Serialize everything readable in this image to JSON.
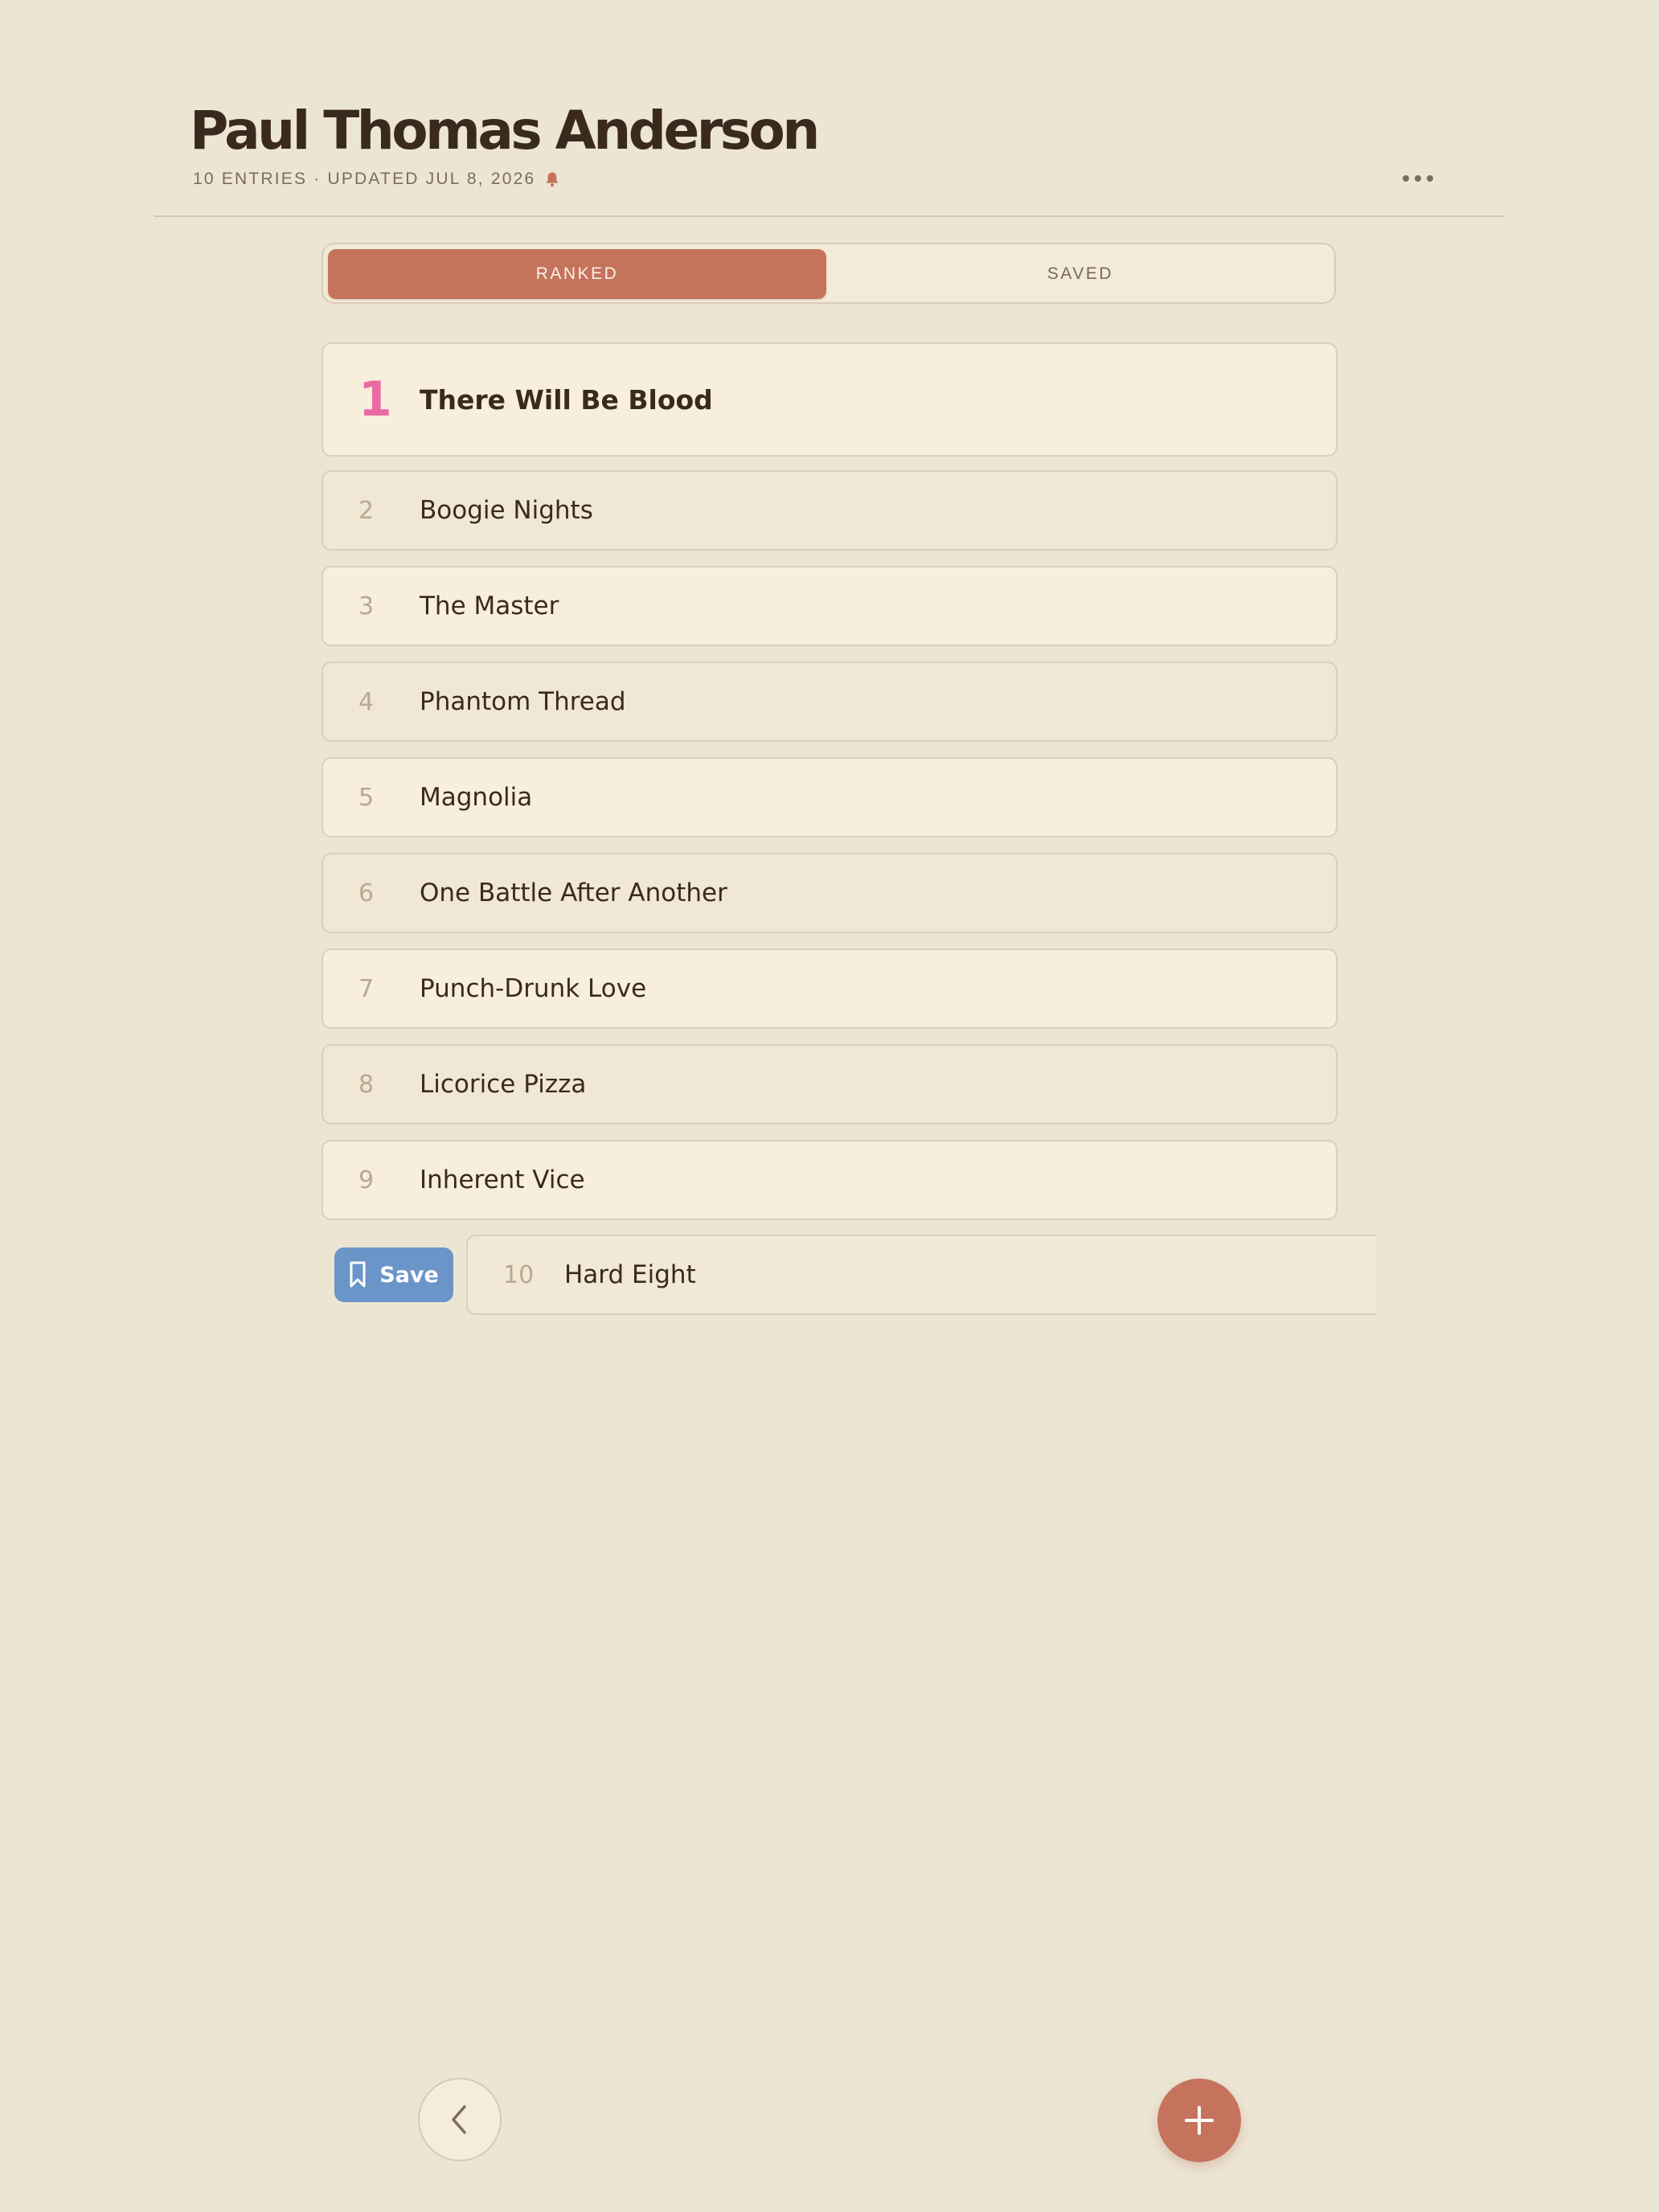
{
  "header": {
    "title": "Paul Thomas Anderson",
    "meta": "10 ENTRIES · UPDATED JUL 8, 2026"
  },
  "tabs": {
    "ranked": "RANKED",
    "saved": "SAVED",
    "active": "ranked"
  },
  "entries": [
    {
      "rank": "1",
      "title": "There Will Be Blood"
    },
    {
      "rank": "2",
      "title": "Boogie Nights"
    },
    {
      "rank": "3",
      "title": "The Master"
    },
    {
      "rank": "4",
      "title": "Phantom Thread"
    },
    {
      "rank": "5",
      "title": "Magnolia"
    },
    {
      "rank": "6",
      "title": "One Battle After Another"
    },
    {
      "rank": "7",
      "title": "Punch-Drunk Love"
    },
    {
      "rank": "8",
      "title": "Licorice Pizza"
    },
    {
      "rank": "9",
      "title": "Inherent Vice"
    },
    {
      "rank": "10",
      "title": "Hard Eight"
    }
  ],
  "swipe_action": {
    "label": "Save",
    "icon": "bookmark-icon",
    "color": "#6b95c8"
  },
  "icons": {
    "meta": "bell-icon",
    "menu": "more-horizontal-icon",
    "back": "chevron-left-icon",
    "add": "plus-icon"
  },
  "colors": {
    "accent": "#c5735c",
    "top_rank": "#ec6aa4",
    "background": "#ede5d4"
  }
}
